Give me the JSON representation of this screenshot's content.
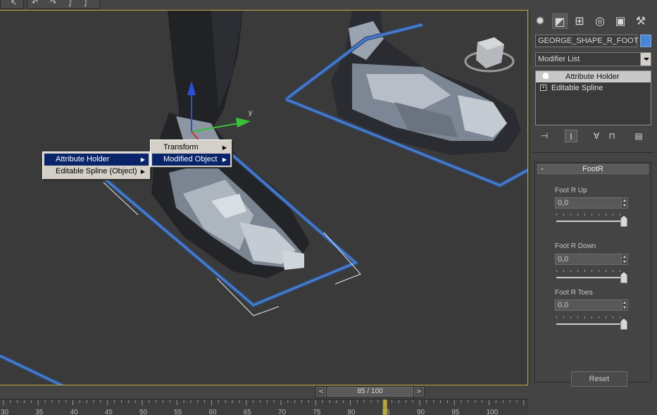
{
  "toolbar": {
    "icons": [
      "select-cursor-icon",
      "undo-icon",
      "redo-icon",
      "link-icon"
    ]
  },
  "viewport": {
    "axis_y_label": "y",
    "context_menu": {
      "items": [
        {
          "label": "Attribute Holder",
          "selected": true
        },
        {
          "label": "Editable Spline (Object)",
          "selected": false
        }
      ]
    },
    "submenu": {
      "items": [
        {
          "label": "Transform",
          "selected": false
        },
        {
          "label": "Modified Object",
          "selected": true
        }
      ]
    }
  },
  "panel": {
    "tabs": [
      "create-icon",
      "modify-icon",
      "hierarchy-icon",
      "motion-icon",
      "display-icon",
      "utilities-icon"
    ],
    "object_name": "GEORGE_SHAPE_R_FOOT",
    "object_color": "#4a86d8",
    "modifier_list_label": "Modifier List",
    "stack": [
      {
        "label": "Attribute Holder",
        "selected": true
      },
      {
        "label": "Editable Spline",
        "selected": false
      }
    ],
    "rollout": {
      "title": "FootR",
      "collapse_symbol": "-",
      "params": [
        {
          "label": "Foot R Up",
          "value": "0,0",
          "slider_fraction": 0.96
        },
        {
          "label": "Foot R Down",
          "value": "0,0",
          "slider_fraction": 0.96
        },
        {
          "label": "Foot R Toes",
          "value": "0,0",
          "slider_fraction": 0.96
        }
      ],
      "reset_label": "Reset"
    }
  },
  "timeline": {
    "frame_display": "85 / 100",
    "prev_symbol": "<",
    "next_symbol": ">",
    "current_frame": 85,
    "ruler_labels": [
      "30",
      "35",
      "40",
      "45",
      "50",
      "55",
      "60",
      "65",
      "70",
      "75",
      "80",
      "85",
      "90",
      "95",
      "100"
    ]
  },
  "colors": {
    "viewport_bg": "#3a3a3a",
    "selection_border": "#c2a63e",
    "spline_blue": "#4a7cc8",
    "menu_highlight": "#0a246a"
  }
}
